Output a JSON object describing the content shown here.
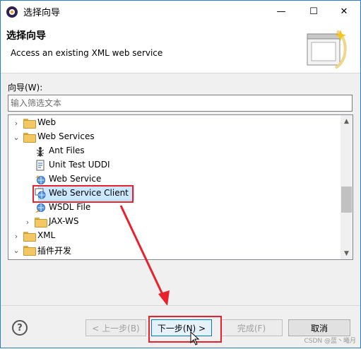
{
  "window": {
    "title": "选择向导",
    "minimize": "—",
    "maximize": "☐",
    "close": "✕"
  },
  "header": {
    "title": "选择向导",
    "description": "Access an existing XML web service"
  },
  "filter": {
    "label": "向导(W):",
    "placeholder": "输入筛选文本"
  },
  "tree": {
    "items": [
      {
        "label": "Web",
        "expanded": false,
        "level": 0,
        "icon": "folder-icon"
      },
      {
        "label": "Web Services",
        "expanded": true,
        "level": 0,
        "icon": "folder-icon"
      },
      {
        "label": "Ant Files",
        "level": 1,
        "icon": "ant-icon"
      },
      {
        "label": "Unit Test UDDI",
        "level": 1,
        "icon": "uddi-icon"
      },
      {
        "label": "Web Service",
        "level": 1,
        "icon": "web-service-icon"
      },
      {
        "label": "Web Service Client",
        "level": 1,
        "icon": "web-service-client-icon",
        "selected": true
      },
      {
        "label": "WSDL File",
        "level": 1,
        "icon": "wsdl-icon"
      },
      {
        "label": "JAX-WS",
        "expanded": false,
        "level": 1,
        "icon": "folder-icon"
      },
      {
        "label": "XML",
        "expanded": false,
        "level": 0,
        "icon": "folder-icon"
      },
      {
        "label": "插件开发",
        "expanded": true,
        "level": 0,
        "icon": "folder-icon"
      }
    ]
  },
  "buttons": {
    "back": "< 上一步(B)",
    "next": "下一步(N) >",
    "finish": "完成(F)",
    "cancel": "取消"
  },
  "help": "?",
  "watermark": "CSDN @蓝丶曦月",
  "colors": {
    "annotation": "#e8212c",
    "selection": "#cce8ff",
    "folder": "#f3c864"
  }
}
